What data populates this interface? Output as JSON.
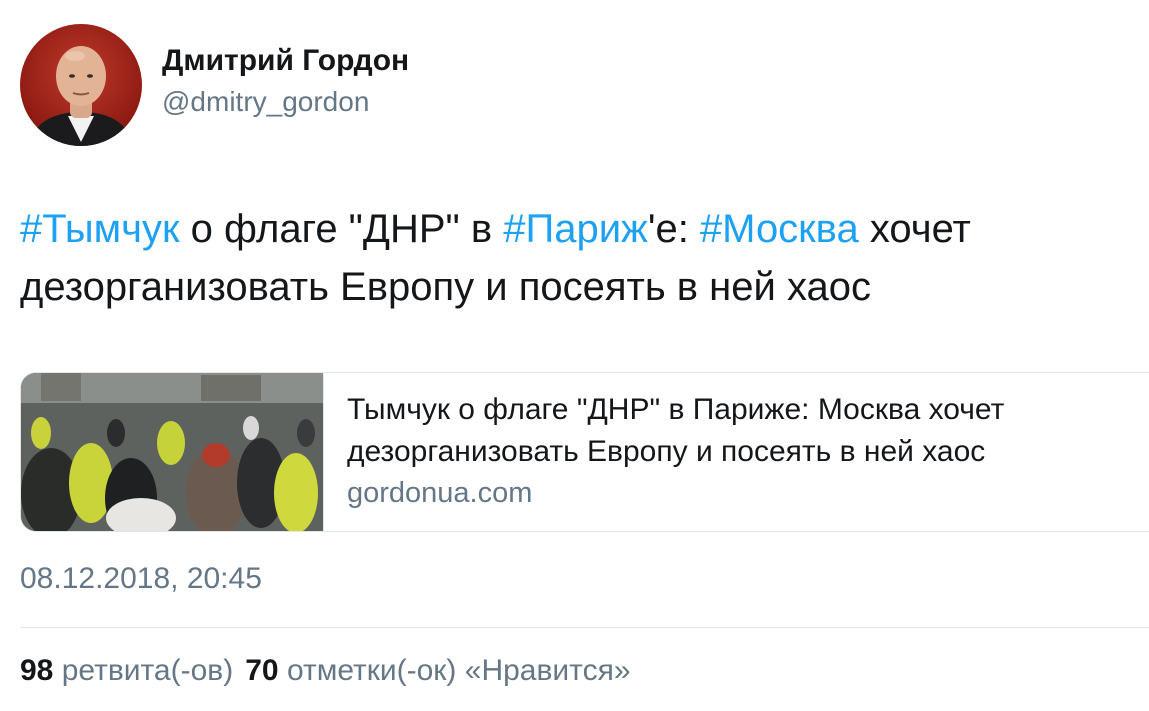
{
  "author": {
    "name": "Дмитрий Гордон",
    "handle": "@dmitry_gordon"
  },
  "tweet": {
    "hashtag_1": "#Тымчук",
    "text_1": " о флаге \"ДНР\" в ",
    "hashtag_2": "#Париж",
    "text_2": "'е: ",
    "hashtag_3": "#Москва",
    "text_3": " хочет дезорганизовать Европу и посеять в ней хаос"
  },
  "card": {
    "title": "Тымчук о флаге \"ДНР\" в Париже: Москва хочет дезорганизовать Европу и посеять в ней хаос",
    "domain": "gordonua.com"
  },
  "timestamp": "08.12.2018, 20:45",
  "stats": {
    "retweets_count": "98",
    "retweets_label": "ретвита(-ов)",
    "likes_count": "70",
    "likes_label": "отметки(-ок) «Нравится»"
  },
  "colors": {
    "link": "#1da1f2",
    "secondary_text": "#657786",
    "primary_text": "#14171a",
    "border": "#e1e8ed"
  }
}
